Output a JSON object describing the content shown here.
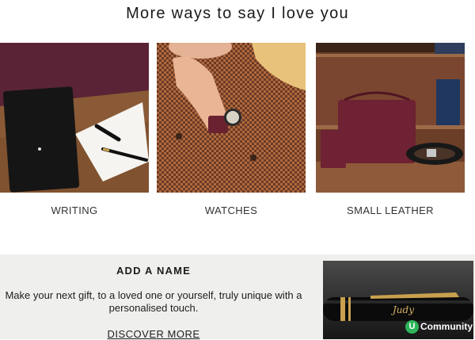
{
  "headline": "More ways to say I love you",
  "categories": [
    {
      "label": "WRITING"
    },
    {
      "label": "WATCHES"
    },
    {
      "label": "SMALL LEATHER"
    }
  ],
  "promo": {
    "title": "ADD A NAME",
    "body": "Make your next gift, to a loved one or yourself, truly unique with a personalised touch.",
    "link_label": "DISCOVER MORE",
    "engraving": "Judy"
  },
  "badge": {
    "mark": "U",
    "label": "Community"
  },
  "colors": {
    "promo_bg": "#efefed",
    "badge_green": "#2fb35a",
    "leather_burgundy": "#6e2233"
  }
}
